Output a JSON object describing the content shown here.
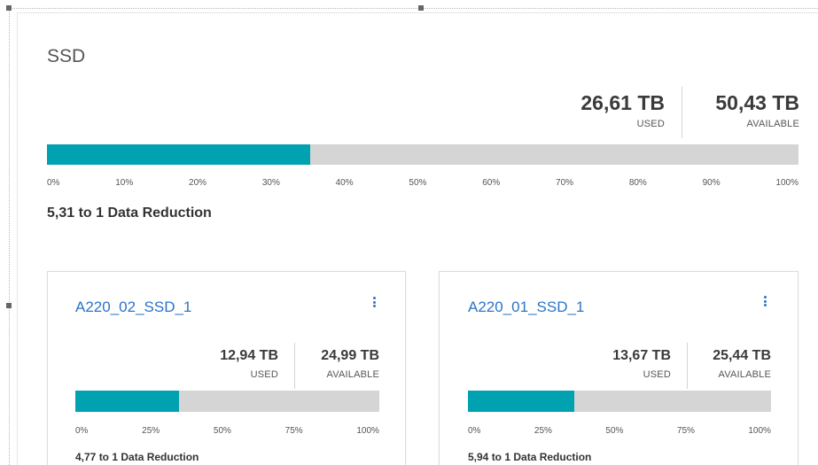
{
  "pool": {
    "title": "SSD",
    "used": "26,61 TB",
    "used_label": "USED",
    "available": "50,43 TB",
    "available_label": "AVAILABLE",
    "used_fraction": 0.35,
    "ticks": [
      "0%",
      "10%",
      "20%",
      "30%",
      "40%",
      "50%",
      "60%",
      "70%",
      "80%",
      "90%",
      "100%"
    ],
    "data_reduction": "5,31 to 1 Data Reduction",
    "bar_color": "#00a1b0",
    "track_color": "#d5d5d5"
  },
  "volumes": [
    {
      "name": "A220_02_SSD_1",
      "used": "12,94 TB",
      "used_label": "USED",
      "available": "24,99 TB",
      "available_label": "AVAILABLE",
      "used_fraction": 0.34,
      "ticks": [
        "0%",
        "25%",
        "50%",
        "75%",
        "100%"
      ],
      "data_reduction": "4,77 to 1 Data Reduction",
      "menu_icon": "kebab-menu-icon"
    },
    {
      "name": "A220_01_SSD_1",
      "used": "13,67 TB",
      "used_label": "USED",
      "available": "25,44 TB",
      "available_label": "AVAILABLE",
      "used_fraction": 0.35,
      "ticks": [
        "0%",
        "25%",
        "50%",
        "75%",
        "100%"
      ],
      "data_reduction": "5,94 to 1 Data Reduction",
      "menu_icon": "kebab-menu-icon"
    }
  ]
}
